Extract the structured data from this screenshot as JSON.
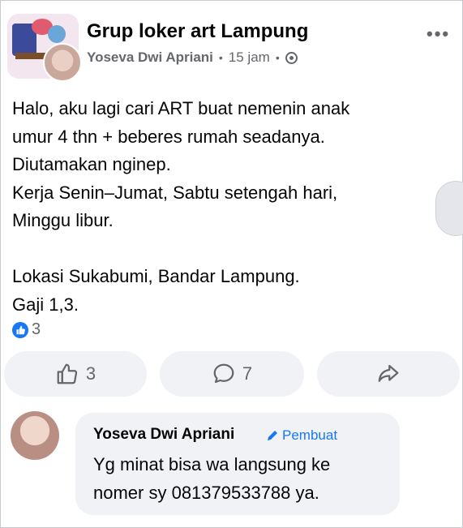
{
  "header": {
    "group_name": "Grup loker art Lampung",
    "author": "Yoseva Dwi Apriani",
    "time": "15 jam",
    "separator": "•"
  },
  "post": {
    "text": "Halo, aku lagi cari ART buat nemenin anak\numur 4 thn + beberes rumah seadanya.\nDiutamakan nginep.\nKerja Senin–Jumat, Sabtu setengah hari,\nMinggu libur.\n\nLokasi Sukabumi, Bandar Lampung.\nGaji 1,3."
  },
  "reactions": {
    "count": "3",
    "icon": "like-icon"
  },
  "actions": {
    "like_count": "3",
    "comment_count": "7"
  },
  "comment": {
    "author": "Yoseva Dwi Apriani",
    "badge": "Pembuat",
    "text": "Yg minat bisa wa langsung ke\nnomer sy 081379533788 ya."
  },
  "colors": {
    "accent": "#1877f2",
    "secondary_text": "#65676b",
    "button_bg": "#f0f2f5"
  }
}
